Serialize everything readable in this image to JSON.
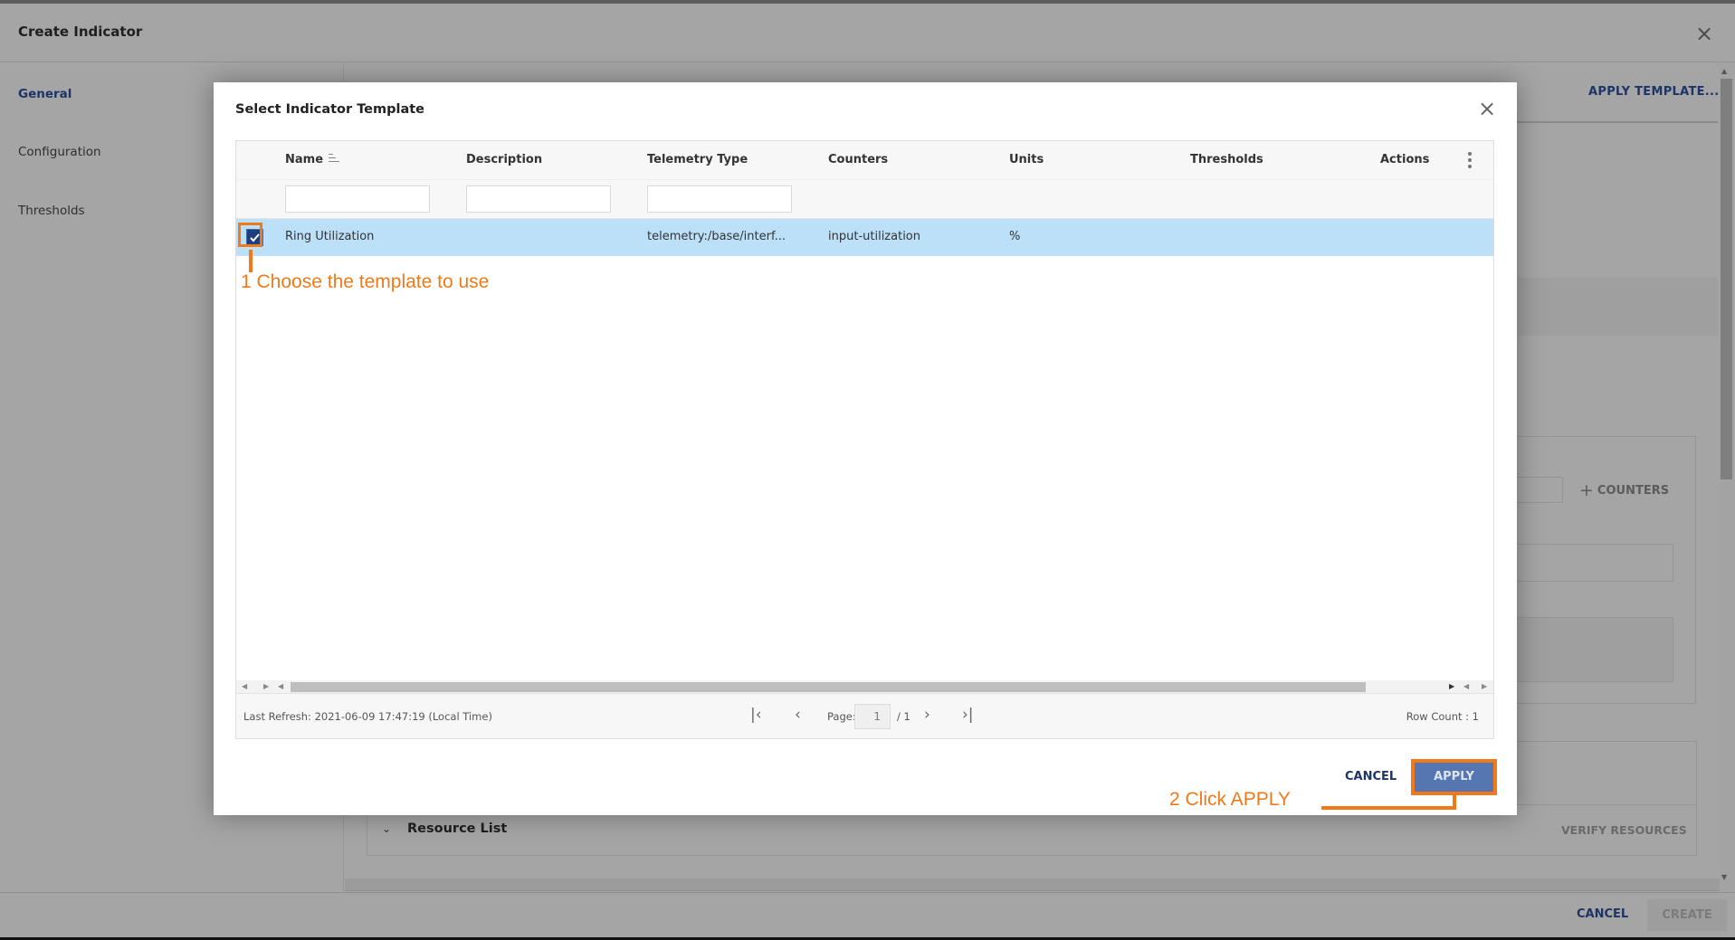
{
  "app": {
    "title": "Create Indicator",
    "close_icon": "close-icon",
    "sidebar": [
      {
        "label": "General",
        "active": true
      },
      {
        "label": "Configuration",
        "active": false
      },
      {
        "label": "Thresholds",
        "active": false
      }
    ],
    "apply_template_label": "APPLY TEMPLATE...",
    "add_counters_label": "COUNTERS",
    "resource_list_title": "Resource List",
    "verify_resources_label": "VERIFY RESOURCES",
    "footer": {
      "cancel_label": "CANCEL",
      "create_label": "CREATE"
    }
  },
  "modal": {
    "title": "Select Indicator Template",
    "columns": [
      "Name",
      "Description",
      "Telemetry Type",
      "Counters",
      "Units",
      "Thresholds",
      "Actions"
    ],
    "filters": {
      "name": "",
      "description": "",
      "telemetry_type": ""
    },
    "rows": [
      {
        "selected": true,
        "name": "Ring Utilization",
        "description": "",
        "telemetry_type": "telemetry:/base/interf...",
        "counters": "input-utilization",
        "units": "%",
        "thresholds": "",
        "actions": ""
      }
    ],
    "footer": {
      "last_refresh": "Last Refresh: 2021-06-09 17:47:19 (Local Time)",
      "page_label": "Page:",
      "page_current": "1",
      "page_total": "/ 1",
      "row_count": "Row Count : 1"
    },
    "cancel_label": "CANCEL",
    "apply_label": "APPLY"
  },
  "annotations": {
    "step1": "1 Choose the template to use",
    "step2": "2 Click APPLY",
    "color": "#f07a1a"
  },
  "colors": {
    "accent": "#1d3566",
    "selected_row": "#bde0f9",
    "apply_button": "#5676b2"
  }
}
